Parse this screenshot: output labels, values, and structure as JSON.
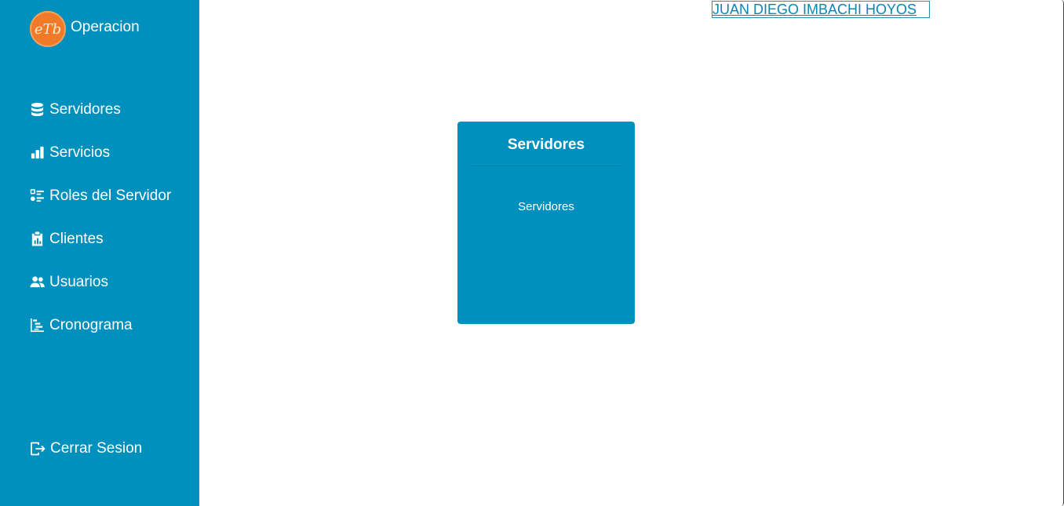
{
  "brand": {
    "logo_text": "eTb",
    "name": "Operacion"
  },
  "sidebar": {
    "items": [
      {
        "label": "Servidores",
        "icon": "database-icon"
      },
      {
        "label": "Servicios",
        "icon": "bar-chart-icon"
      },
      {
        "label": "Roles del Servidor",
        "icon": "list-icon"
      },
      {
        "label": "Clientes",
        "icon": "clipboard-icon"
      },
      {
        "label": "Usuarios",
        "icon": "users-icon"
      },
      {
        "label": "Cronograma",
        "icon": "gantt-icon"
      }
    ],
    "logout_label": "Cerrar Sesion",
    "logout_icon": "sign-out-icon"
  },
  "header": {
    "user_name": "JUAN DIEGO IMBACHI HOYOS"
  },
  "card": {
    "title": "Servidores",
    "text": "Servidores"
  },
  "colors": {
    "primary": "#0090bd",
    "logo": "#f07a28",
    "link": "#0b86b3"
  }
}
